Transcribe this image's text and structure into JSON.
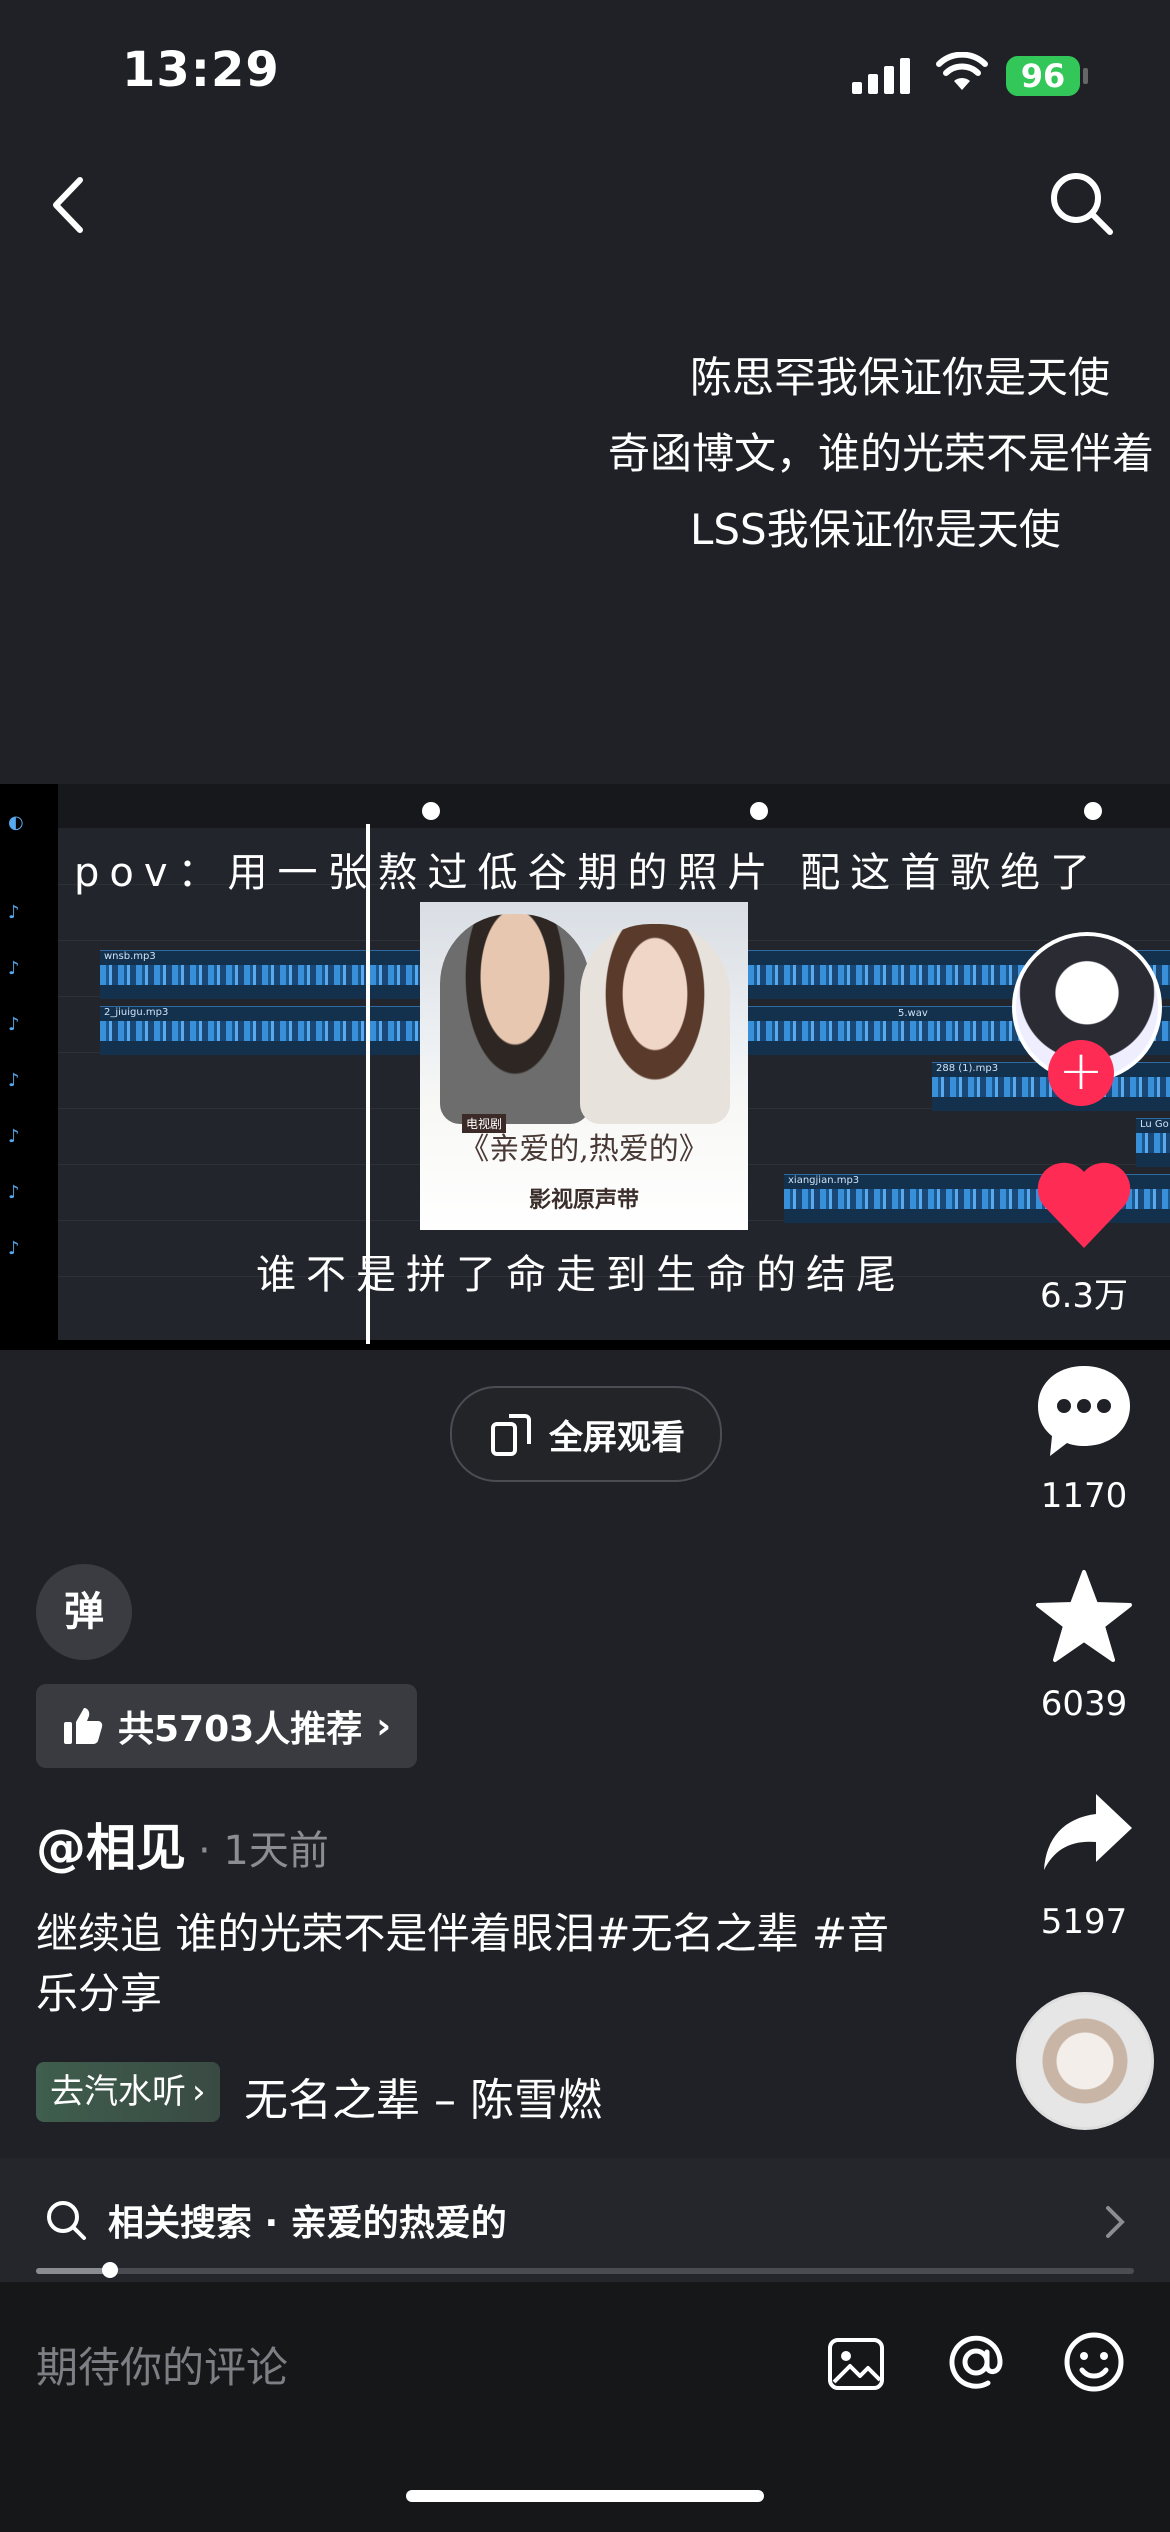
{
  "status_bar": {
    "time": "13:29",
    "battery": "96"
  },
  "lyrics": [
    "陈思罕我保证你是天使",
    "奇函博文，谁的光荣不是伴着",
    "LSS我保证你是天使"
  ],
  "video": {
    "caption": "pov：用一张熬过低谷期的照片 配这首歌绝了",
    "subtitle": "谁不是拼了命走到生命的结尾",
    "tracks": [
      "wnsb.mp3",
      "2_jiuigu.mp3",
      "5.wav",
      "288 (1).mp3",
      "xiangjian.mp3",
      "Lu Go"
    ],
    "album_title": "《亲爱的,热爱的》",
    "album_subtitle": "影视原声带",
    "album_tag": "电视剧"
  },
  "actions": {
    "likes": "6.3万",
    "comments": "1170",
    "favorites": "6039",
    "shares": "5197"
  },
  "fullscreen_label": "全屏观看",
  "danmaku_label": "弹",
  "recommend_label": "共5703人推荐",
  "author": "@相见",
  "post_time": "· 1天前",
  "description": "继续追 谁的光荣不是伴着眼泪#无名之辈 #音乐分享",
  "music": {
    "tag": "去汽水听",
    "name": "无名之辈 – 陈雪燃"
  },
  "related_search": "相关搜索 · 亲爱的热爱的",
  "comment_placeholder": "期待你的评论",
  "colors": {
    "accent": "#fe2c55",
    "background": "#1f2126"
  }
}
